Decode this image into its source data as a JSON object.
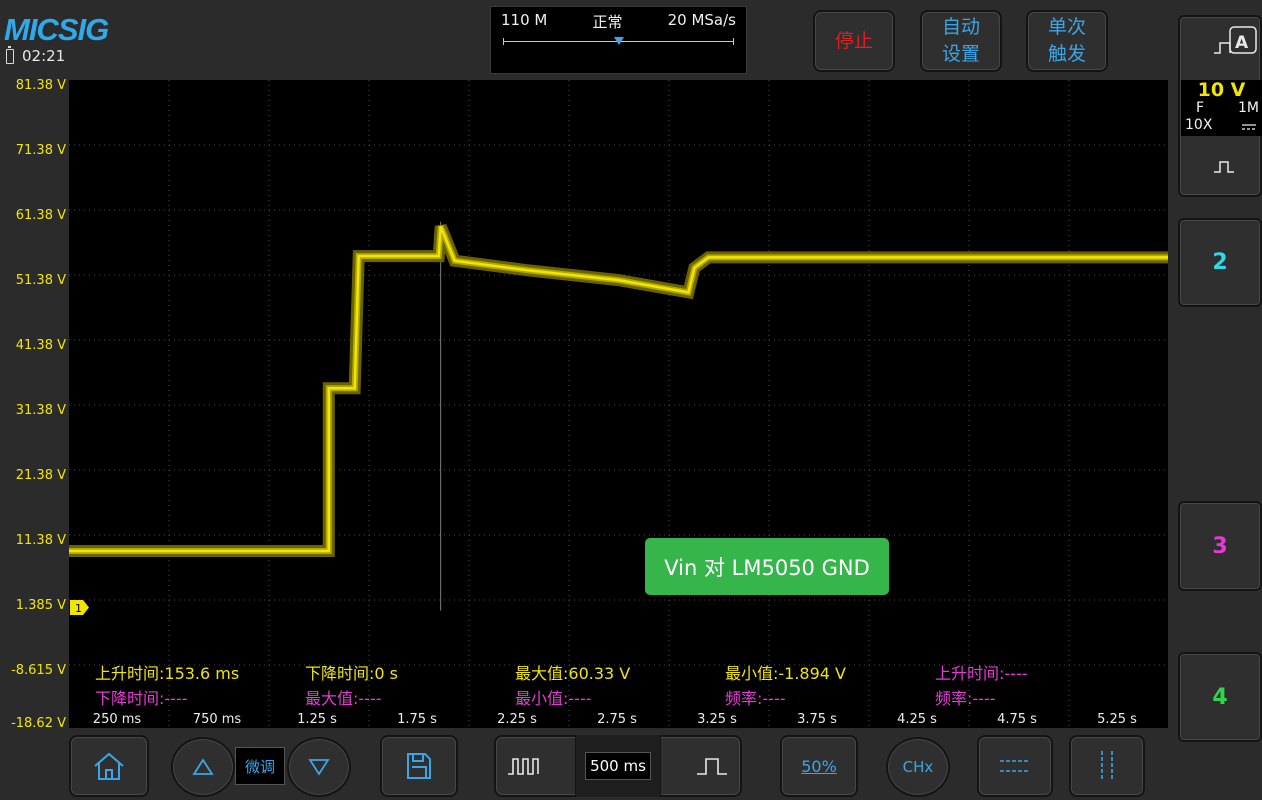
{
  "header": {
    "brand": "MICSIG",
    "time": "02:21",
    "memory_depth": "110 M",
    "acq_mode": "正常",
    "sample_rate": "20 MSa/s",
    "stop_label": "停止",
    "auto_label": "自动\n设置",
    "single_label": "单次\n触发"
  },
  "colors": {
    "ch1": "#f2e600",
    "ch2": "#2fd9e6",
    "ch3": "#e63ad8",
    "ch4": "#30d64a",
    "accent": "#3aa6e8",
    "stop": "#e11d1d"
  },
  "channel1": {
    "scale": "10 V",
    "coupling": "F",
    "impedance": "1M",
    "probe": "10X",
    "marker": "1"
  },
  "channels": [
    {
      "id": "2"
    },
    {
      "id": "3"
    },
    {
      "id": "4"
    }
  ],
  "y_axis_labels": [
    "81.38 V",
    "71.38 V",
    "61.38 V",
    "51.38 V",
    "41.38 V",
    "31.38 V",
    "21.38 V",
    "11.38 V",
    "1.385 V",
    "-8.615 V",
    "-18.62 V"
  ],
  "x_axis_labels": [
    "250 ms",
    "750 ms",
    "1.25 s",
    "1.75 s",
    "2.25 s",
    "2.75 s",
    "3.25 s",
    "3.75 s",
    "4.25 s",
    "4.75 s",
    "5.25 s"
  ],
  "measurements": {
    "row1": [
      "上升时间:153.6 ms",
      "下降时间:0 s",
      "最大值:60.33 V",
      "最小值:-1.894 V",
      "上升时间:----"
    ],
    "row2": [
      "下降时间:----",
      "最大值:----",
      "最小值:----",
      "频率:----",
      "频率:----"
    ]
  },
  "annotation": "Vin 对 LM5050 GND",
  "bottom": {
    "fine_label": "微调",
    "timebase": "500 ms",
    "trigger_level": "50%",
    "channel_select": "CHx"
  },
  "chart_data": {
    "type": "line",
    "x_unit": "s",
    "y_unit": "V",
    "xlim": [
      0,
      5.5
    ],
    "ylim": [
      -18.62,
      81.38
    ],
    "series": [
      {
        "x": [
          0,
          1.3,
          1.3,
          1.43,
          1.45,
          1.85,
          1.86,
          1.93,
          2.3,
          2.75,
          3.1,
          3.13,
          3.2,
          5.5
        ],
        "y": [
          8.7,
          8.7,
          33.8,
          33.8,
          54.2,
          54.2,
          58.8,
          53.5,
          52.0,
          50.5,
          48.6,
          52.4,
          54.0,
          54.0
        ]
      }
    ],
    "glitch": {
      "x": 1.86,
      "y_top": 59.5,
      "y_bottom": -0.5
    }
  }
}
